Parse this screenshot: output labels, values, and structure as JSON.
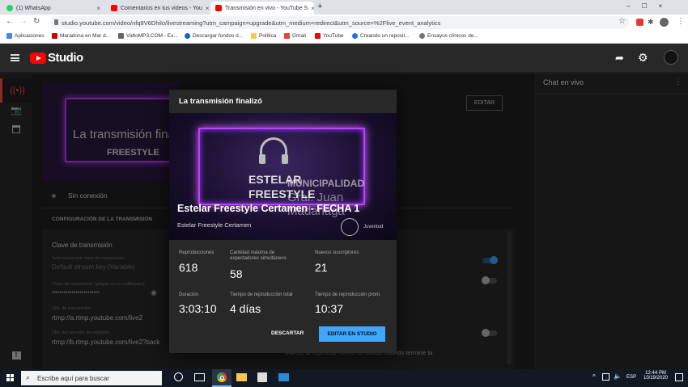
{
  "browser": {
    "tabs": [
      {
        "label": "(1) WhatsApp",
        "color": "#25d366"
      },
      {
        "label": "Comentarios en tus videos - You",
        "color": "#ff0000"
      },
      {
        "label": "Transmisión en vivo - YouTube S",
        "color": "#ff0000"
      }
    ],
    "url": "studio.youtube.com/video/nfq8V6Dhilo/livestreaming?utm_campaign=upgrade&utm_medium=redirect&utm_source=%2Flive_event_analytics",
    "bookmarks": [
      "Aplicaciones",
      "Maradona en Mar d...",
      "VidtoMP3.COM - Ex...",
      "Descargar fondos d...",
      "Política",
      "Gmail",
      "YouTube",
      "Creando un reposit...",
      "Ensayos clínicos de..."
    ]
  },
  "studio": {
    "logo": "Studio",
    "chat_title": "Chat en vivo",
    "main": {
      "preview_title": "La transmisión final",
      "preview_brand": "FREESTYLE",
      "status": "Sin conexión",
      "edit_button": "EDITAR",
      "config_title": "CONFIGURACIÓN DE LA TRANSMISIÓN",
      "key_title": "Clave de transmisión",
      "key_select_label": "Selecciona una clave de transmisión",
      "key_select_value": "Default stream key (Variable)",
      "key_field_label": "Clave de transmisión (pégala en el codificador)",
      "key_field_value": "••••••••••••••••••••••••",
      "url_label": "URL de transmisión",
      "url_value": "rtmp://a.rtmp.youtube.com/live2",
      "backup_label": "URL del servidor de respaldo",
      "backup_value": "rtmp://b.rtmp.youtube.com/live2?back",
      "bottom_text": "Marcar la repetición como no listada cuando termine la"
    }
  },
  "modal": {
    "title": "La transmisión finalizó",
    "video_title": "Estelar Freestyle Certamen - FECHA 1",
    "channel": "Estelar Freestyle Certamen",
    "thumb_brand_1": "ESTELAR",
    "thumb_brand_2": "FREESTYLE",
    "thumb_overlay_1": "MUNICIPALIDAD",
    "thumb_overlay_2": "Gral. Juan Madariaga",
    "thumb_overlay_3": "Juventud",
    "stats": [
      {
        "label": "Reproducciones",
        "value": "618"
      },
      {
        "label": "Cantidad máxima de espectadores simultáneos",
        "value": "58"
      },
      {
        "label": "Nuevos suscriptores",
        "value": "21"
      },
      {
        "label": "Duración",
        "value": "3:03:10"
      },
      {
        "label": "Tiempo de reproducción total",
        "value": "4 días"
      },
      {
        "label": "Tiempo de reproducción prom.",
        "value": "10:37"
      }
    ],
    "discard_button": "DESCARTAR",
    "edit_studio_button": "EDITAR EN STUDIO"
  },
  "taskbar": {
    "search_placeholder": "Escribe aquí para buscar",
    "lang": "ESP",
    "time": "12:44 PM",
    "date": "10/19/2020"
  }
}
